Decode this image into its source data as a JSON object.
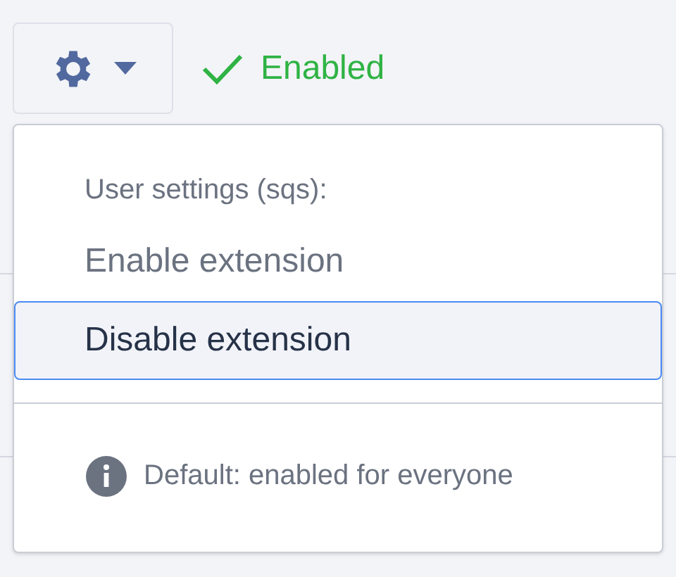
{
  "toolbar": {
    "status": {
      "label": "Enabled",
      "on": true
    }
  },
  "menu": {
    "header": "User settings (sqs):",
    "items": [
      {
        "label": "Enable extension",
        "disabled": true,
        "selected": false
      },
      {
        "label": "Disable extension",
        "disabled": false,
        "selected": true
      }
    ],
    "footer": "Default: enabled for everyone"
  }
}
